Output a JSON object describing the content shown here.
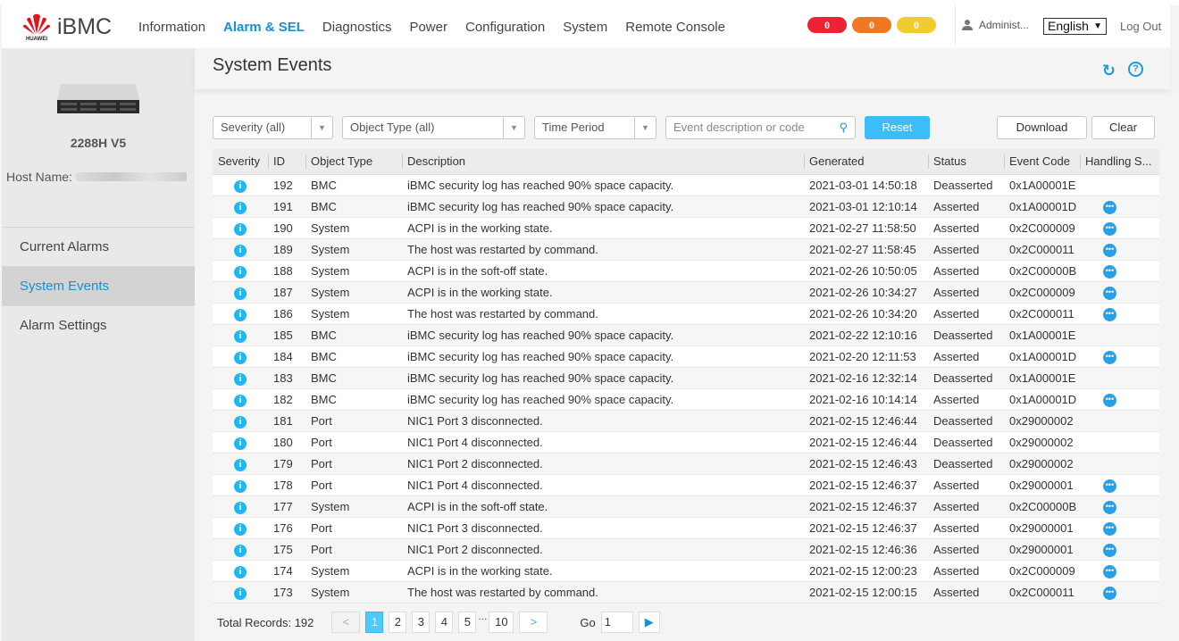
{
  "header": {
    "brand": "iBMC",
    "logo_text": "HUAWEI",
    "nav": [
      "Information",
      "Alarm & SEL",
      "Diagnostics",
      "Power",
      "Configuration",
      "System",
      "Remote Console"
    ],
    "active_nav": 1,
    "badges": [
      {
        "value": "0",
        "color": "#ee2233"
      },
      {
        "value": "0",
        "color": "#f07820"
      },
      {
        "value": "0",
        "color": "#f0cc30"
      }
    ],
    "user": "Administ...",
    "language": "English",
    "logout": "Log Out"
  },
  "sidebar": {
    "model": "2288H V5",
    "host_label": "Host Name:",
    "menu": [
      "Current Alarms",
      "System Events",
      "Alarm Settings"
    ],
    "active": 1
  },
  "main": {
    "title": "System Events",
    "filters": {
      "severity": "Severity (all)",
      "object_type": "Object Type (all)",
      "time_period": "Time Period",
      "search_placeholder": "Event description or code"
    },
    "buttons": {
      "reset": "Reset",
      "download": "Download",
      "clear": "Clear"
    },
    "columns": [
      "Severity",
      "ID",
      "Object Type",
      "Description",
      "Generated",
      "Status",
      "Event Code",
      "Handling S..."
    ],
    "rows": [
      [
        "192",
        "BMC",
        "iBMC security log has reached 90% space capacity.",
        "2021-03-01 14:50:18",
        "Deasserted",
        "0x1A00001E"
      ],
      [
        "191",
        "BMC",
        "iBMC security log has reached 90% space capacity.",
        "2021-03-01 12:10:14",
        "Asserted",
        "0x1A00001D"
      ],
      [
        "190",
        "System",
        "ACPI is in the working state.",
        "2021-02-27 11:58:50",
        "Asserted",
        "0x2C000009"
      ],
      [
        "189",
        "System",
        "The host was restarted by command.",
        "2021-02-27 11:58:45",
        "Asserted",
        "0x2C000011"
      ],
      [
        "188",
        "System",
        "ACPI is in the soft-off state.",
        "2021-02-26 10:50:05",
        "Asserted",
        "0x2C00000B"
      ],
      [
        "187",
        "System",
        "ACPI is in the working state.",
        "2021-02-26 10:34:27",
        "Asserted",
        "0x2C000009"
      ],
      [
        "186",
        "System",
        "The host was restarted by command.",
        "2021-02-26 10:34:20",
        "Asserted",
        "0x2C000011"
      ],
      [
        "185",
        "BMC",
        "iBMC security log has reached 90% space capacity.",
        "2021-02-22 12:10:16",
        "Deasserted",
        "0x1A00001E"
      ],
      [
        "184",
        "BMC",
        "iBMC security log has reached 90% space capacity.",
        "2021-02-20 12:11:53",
        "Asserted",
        "0x1A00001D"
      ],
      [
        "183",
        "BMC",
        "iBMC security log has reached 90% space capacity.",
        "2021-02-16 12:32:14",
        "Deasserted",
        "0x1A00001E"
      ],
      [
        "182",
        "BMC",
        "iBMC security log has reached 90% space capacity.",
        "2021-02-16 10:14:14",
        "Asserted",
        "0x1A00001D"
      ],
      [
        "181",
        "Port",
        "NIC1 Port 3 disconnected.",
        "2021-02-15 12:46:44",
        "Deasserted",
        "0x29000002"
      ],
      [
        "180",
        "Port",
        "NIC1 Port 4 disconnected.",
        "2021-02-15 12:46:44",
        "Deasserted",
        "0x29000002"
      ],
      [
        "179",
        "Port",
        "NIC1 Port 2 disconnected.",
        "2021-02-15 12:46:43",
        "Deasserted",
        "0x29000002"
      ],
      [
        "178",
        "Port",
        "NIC1 Port 4 disconnected.",
        "2021-02-15 12:46:37",
        "Asserted",
        "0x29000001"
      ],
      [
        "177",
        "System",
        "ACPI is in the soft-off state.",
        "2021-02-15 12:46:37",
        "Asserted",
        "0x2C00000B"
      ],
      [
        "176",
        "Port",
        "NIC1 Port 3 disconnected.",
        "2021-02-15 12:46:37",
        "Asserted",
        "0x29000001"
      ],
      [
        "175",
        "Port",
        "NIC1 Port 2 disconnected.",
        "2021-02-15 12:46:36",
        "Asserted",
        "0x29000001"
      ],
      [
        "174",
        "System",
        "ACPI is in the working state.",
        "2021-02-15 12:00:23",
        "Asserted",
        "0x2C000009"
      ],
      [
        "173",
        "System",
        "The host was restarted by command.",
        "2021-02-15 12:00:15",
        "Asserted",
        "0x2C000011"
      ]
    ],
    "pager": {
      "total_label": "Total Records: 192",
      "pages": [
        "1",
        "2",
        "3",
        "4",
        "5"
      ],
      "ellipsis": "···",
      "last": "10",
      "current": 1,
      "go_label": "Go",
      "go_value": "1"
    }
  }
}
